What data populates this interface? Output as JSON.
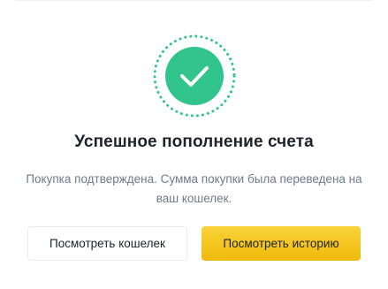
{
  "dialog": {
    "icon": "check-circle-icon",
    "title": "Успешное пополнение счета",
    "message": "Покупка подтверждена. Сумма покупки была переведена на ваш кошелек.",
    "secondary_button": "Посмотреть кошелек",
    "primary_button": "Посмотреть историю"
  },
  "colors": {
    "success": "#31c48d",
    "accent": "#f0b90b",
    "title": "#1e2329",
    "muted_text": "#707a8a"
  }
}
